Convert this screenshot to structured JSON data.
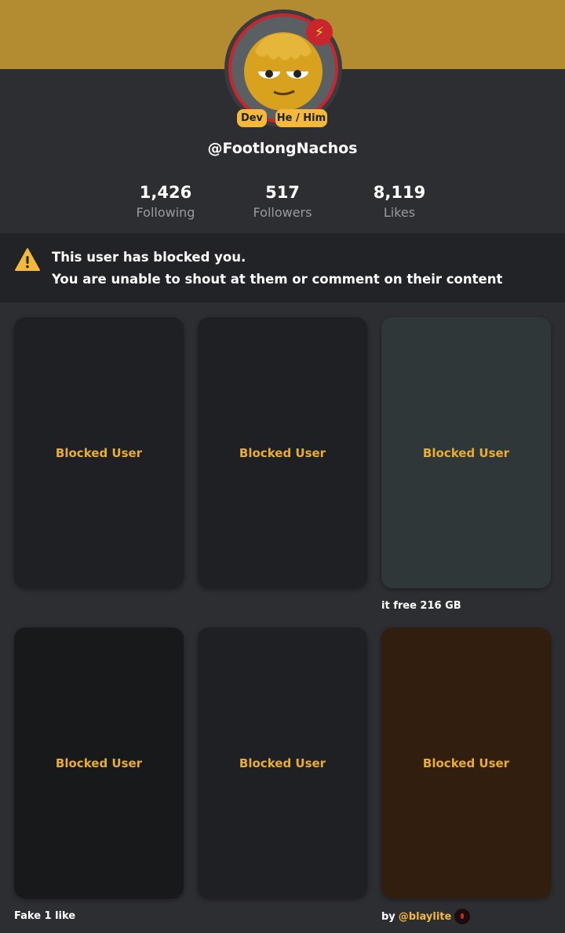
{
  "profile": {
    "username": "@FootlongNachos",
    "tags": [
      "Dev",
      "He / Him"
    ],
    "badge_icon": "lightning-bolt-icon",
    "colors": {
      "banner": "#b38b30",
      "accent": "#f3b83c",
      "ring": "#c8252d"
    }
  },
  "stats": [
    {
      "value": "1,426",
      "label": "Following"
    },
    {
      "value": "517",
      "label": "Followers"
    },
    {
      "value": "8,119",
      "label": "Likes"
    }
  ],
  "blocked_notice": {
    "line1": "This user has blocked you.",
    "line2": "You are unable to shout at them or comment on their content",
    "icon": "warning-icon"
  },
  "cards": [
    {
      "label": "Blocked User",
      "caption": ""
    },
    {
      "label": "Blocked User",
      "caption": ""
    },
    {
      "label": "Blocked User",
      "caption": "it free 216 GB"
    },
    {
      "label": "Blocked User",
      "caption": "Fake 1 like"
    },
    {
      "label": "Blocked User",
      "caption": ""
    },
    {
      "label": "Blocked User",
      "caption_prefix": "by ",
      "caption_handle": "@blaylite"
    }
  ]
}
